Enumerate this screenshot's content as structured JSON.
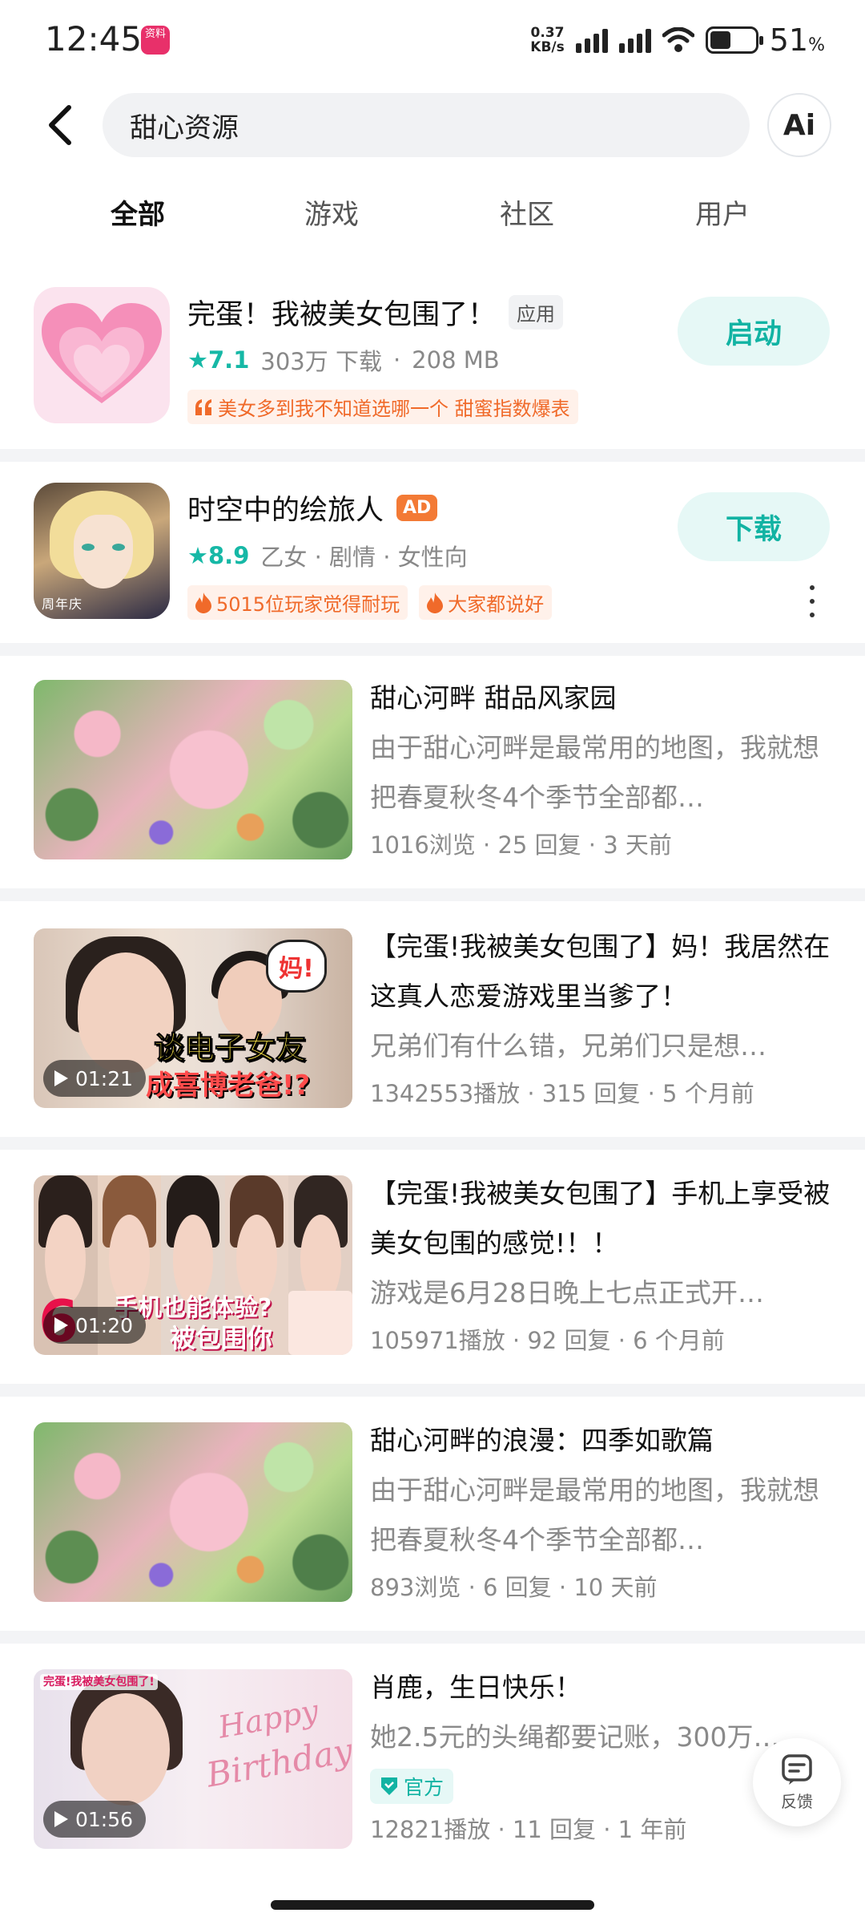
{
  "status_bar": {
    "time": "12:45",
    "app_badge": "资料",
    "net_speed_value": "0.37",
    "net_speed_unit": "KB/s",
    "battery_percent": "51",
    "battery_unit": "%"
  },
  "search": {
    "query": "甜心资源",
    "ai_label": "Ai"
  },
  "tabs": [
    {
      "label": "全部"
    },
    {
      "label": "游戏"
    },
    {
      "label": "社区"
    },
    {
      "label": "用户"
    }
  ],
  "apps": [
    {
      "title": "完蛋！我被美女包围了！",
      "tag": "应用",
      "rating": "7.1",
      "downloads": "303万 下载",
      "size": "208 MB",
      "highlight": "美女多到我不知道选哪一个 甜蜜指数爆表",
      "action": "启动"
    },
    {
      "title": "时空中的绘旅人",
      "tag": "AD",
      "rating": "8.9",
      "genres": "乙女 · 剧情 · 女性向",
      "icon_caption": "周年庆",
      "pill1": "5015位玩家觉得耐玩",
      "pill2": "大家都说好",
      "action": "下载"
    }
  ],
  "posts": [
    {
      "title": "甜心河畔 甜品风家园",
      "desc": "由于甜心河畔是最常用的地图，我就想把春夏秋冬4个季节全部都…",
      "stats": "1016浏览 · 25 回复 · 3 天前"
    },
    {
      "title": "【完蛋!我被美女包围了】妈！我居然在这真人恋爱游戏里当爹了！",
      "desc": "兄弟们有什么错，兄弟们只是想…",
      "stats": "1342553播放 · 315 回复 · 5 个月前",
      "duration": "01:21",
      "thumb_caption1": "谈电子女友",
      "thumb_caption2": "成喜博老爸!?",
      "thumb_bubble": "妈!"
    },
    {
      "title": "【完蛋!我被美女包围了】手机上享受被美女包围的感觉!！！",
      "desc": "游戏是6月28日晚上七点正式开…",
      "stats": "105971播放 · 92 回复 · 6 个月前",
      "duration": "01:20",
      "thumb_caption1": "手机也能体验?",
      "thumb_caption2": "被包围你",
      "thumb_number": "6"
    },
    {
      "title": "甜心河畔的浪漫：四季如歌篇",
      "desc": "由于甜心河畔是最常用的地图，我就想把春夏秋冬4个季节全部都…",
      "stats": "893浏览 · 6 回复 · 10 天前"
    },
    {
      "title": "肖鹿，生日快乐！",
      "desc": "她2.5元的头绳都要记账，300万…",
      "official": "官方",
      "stats": "12821播放 · 11 回复 · 1 年前",
      "duration": "01:56",
      "thumb_logo": "完蛋!我被美女包围了!",
      "thumb_happy": "Happy",
      "thumb_birthday": "Birthday"
    }
  ],
  "feedback": {
    "label": "反馈"
  },
  "colors": {
    "accent": "#12b3a3",
    "accent_light": "#e6f8f6",
    "orange": "#f06a2a",
    "ad_badge": "#f37a35"
  }
}
